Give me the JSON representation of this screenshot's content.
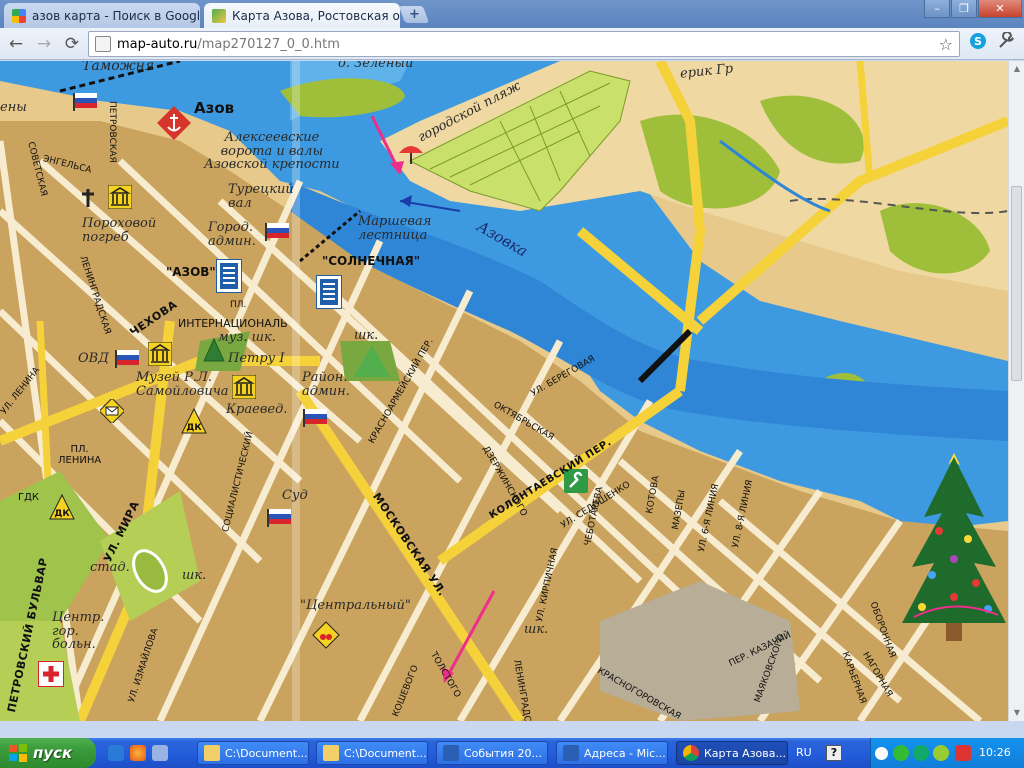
{
  "browser": {
    "tabs": [
      {
        "label": "азов карта - Поиск в Google",
        "active": false,
        "favicon": "google-favicon"
      },
      {
        "label": "Карта Азова, Ростовская об",
        "active": true,
        "favicon": "map-favicon"
      }
    ],
    "new_tab_symbol": "+",
    "window_controls": {
      "minimize": "–",
      "maximize": "❐",
      "close": "✕"
    },
    "nav": {
      "back": "←",
      "forward": "→",
      "reload": "⟳"
    },
    "url_host": "map-auto.ru",
    "url_path": "/map270127_0_0.htm",
    "bookmark_star": "☆",
    "menu_icon": "wrench-icon"
  },
  "map": {
    "labels": {
      "tamozhnya": "Таможня",
      "ieny": "ены",
      "azov": "Азов",
      "alekseevskie": "Алексеевские\nворота и валы\nАзовской крепости",
      "turetsky_val": "Турецкий\nвал",
      "porokhovoy": "Пороховой\nпогреб",
      "gorod_admin": "Город.\nадмин.",
      "marshevaya": "Маршевая\nлестница",
      "solnechnaya": "\"СОЛНЕЧНАЯ\"",
      "azov_hotel": "\"АЗОВ\"",
      "internatsionalnaya": "ИНТЕРНАЦИОНАЛЬ",
      "muz_shk": "муз. шк.",
      "pl": "ПЛ.",
      "petru_i": "Петру I",
      "ovd": "ОВД",
      "muzey": "Музей Р.Л.\nСамойловича",
      "kraeved": "Краевед.",
      "rayon_admin": "Район.\nадмин.",
      "shk1": "шк.",
      "dk1": "ДК",
      "dk2": "ДК",
      "pl_lenina": "ПЛ.\nЛЕНИНА",
      "sud": "Суд",
      "gdk": "ГДК",
      "stad": "стад.",
      "shk2": "шк.",
      "tsentralny": "\"Центральный\"",
      "tsentr_gor": "Центр.\nгор.\nбольн.",
      "shk3": "шк.",
      "gorodskoy_plyazh": "городской пляж",
      "ostrov": "о. Зеленый",
      "erik": "ерик Гр",
      "river_azovka": "Азовка",
      "st_moskovskaya": "МОСКОВСКАЯ УЛ.",
      "st_mira": "УЛ. МИРА",
      "st_chekhova": "ЧЕХОВА",
      "st_petrovsky_blvd": "ПЕТРОВСКИЙ БУЛЬВАР",
      "st_kolontaevsky": "КОЛОНТАЕВСКИЙ ПЕР.",
      "st_beregovaya": "УЛ. БЕРЕГОВАЯ",
      "st_oktyabrskaya": "ОКТЯБРЬСКАЯ",
      "st_sedoshenko": "УЛ. СЕДОШЕНКО",
      "st_kotova": "КОТОВА",
      "st_mazepy": "МАЗЕПЫ",
      "st_chebotareva": "ЧЕБОТАРЕВА",
      "st_kirpichnaya": "УЛ. КИРПИЧНАЯ",
      "st_krasnoarmeysky": "КРАСНОАРМЕЙСКИЙ ПЕР.",
      "st_leningradskaya": "ЛЕНИНГРАДСКАЯ УЛ.",
      "st_krasnogorovskaya": "КРАСНОГОРОВСКАЯ",
      "st_kazachiy": "ПЕР. КАЗАЧИЙ",
      "st_izmailova": "УЛ. ИЗМАЙЛОВА",
      "st_sotsialisticheskiy": "СОЦИАЛИСТИЧЕСКИЙ",
      "st_lenina": "УЛ. ЛЕНИНА",
      "st_petrovsky_blvd2": "ПЕТРОВСКИЙ БУЛЬВАР",
      "st_6_liniya": "УЛ. 6-Я ЛИНИЯ",
      "st_8_liniya": "УЛ. 8-Я ЛИНИЯ",
      "st_oboronnaya": "ОБОРОННАЯ",
      "st_naberezhnaya": "НАГОРНАЯ",
      "st_karyernaya": "КАРЬЕРНАЯ",
      "st_mayakovskogo": "МАЯКОВСКОГО",
      "st_koshevogo": "КОШЕВОГО",
      "st_dzerzhinskogo": "ДЗЕРЖИНСКОГО",
      "st_petrovskaya": "ПЕТРОВСКАЯ",
      "st_sovetskaya": "СОВЕТСКАЯ",
      "st_engelsa": "ЭНГЕЛЬСА",
      "st_leninrdskaya": "ЛЕНИНГРАДСКАЯ",
      "st_tolstogo": "ТОЛСТОГО"
    }
  },
  "taskbar": {
    "start_label": "пуск",
    "tasks": [
      {
        "label": "C:\\Document...",
        "icon": "folder-icon",
        "active": false
      },
      {
        "label": "C:\\Document...",
        "icon": "folder-icon",
        "active": false
      },
      {
        "label": "События 20...",
        "icon": "word-icon",
        "active": false
      },
      {
        "label": "Адреса - Mic...",
        "icon": "word-icon",
        "active": false
      },
      {
        "label": "Карта Азова...",
        "icon": "chrome-icon",
        "active": true
      }
    ],
    "lang": "RU",
    "help_icon": "?",
    "clock": "10:26"
  }
}
